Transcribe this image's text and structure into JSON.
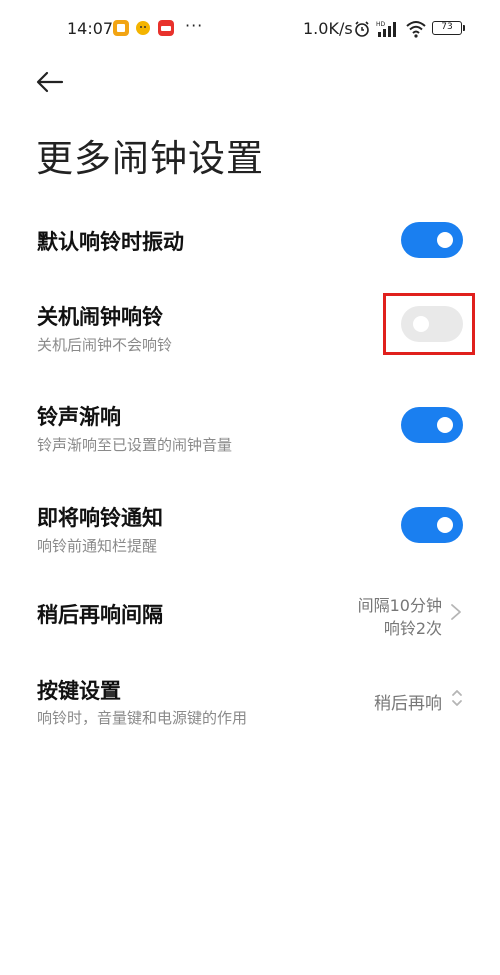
{
  "status_bar": {
    "time": "14:07",
    "speed": "1.0K/s",
    "battery": "73"
  },
  "page": {
    "title": "更多闹钟设置"
  },
  "settings": [
    {
      "title": "默认响铃时振动",
      "toggle": true
    },
    {
      "title": "关机闹钟响铃",
      "subtitle": "关机后闹钟不会响铃",
      "toggle": false,
      "highlighted": true
    },
    {
      "title": "铃声渐响",
      "subtitle": "铃声渐响至已设置的闹钟音量",
      "toggle": true
    },
    {
      "title": "即将响铃通知",
      "subtitle": "响铃前通知栏提醒",
      "toggle": true
    },
    {
      "title": "稍后再响间隔",
      "value_line1": "间隔10分钟",
      "value_line2": "响铃2次"
    },
    {
      "title": "按键设置",
      "subtitle": "响铃时，音量键和电源键的作用",
      "value": "稍后再响"
    }
  ],
  "colors": {
    "accent": "#1a7ff0",
    "highlight": "#e0201d"
  }
}
